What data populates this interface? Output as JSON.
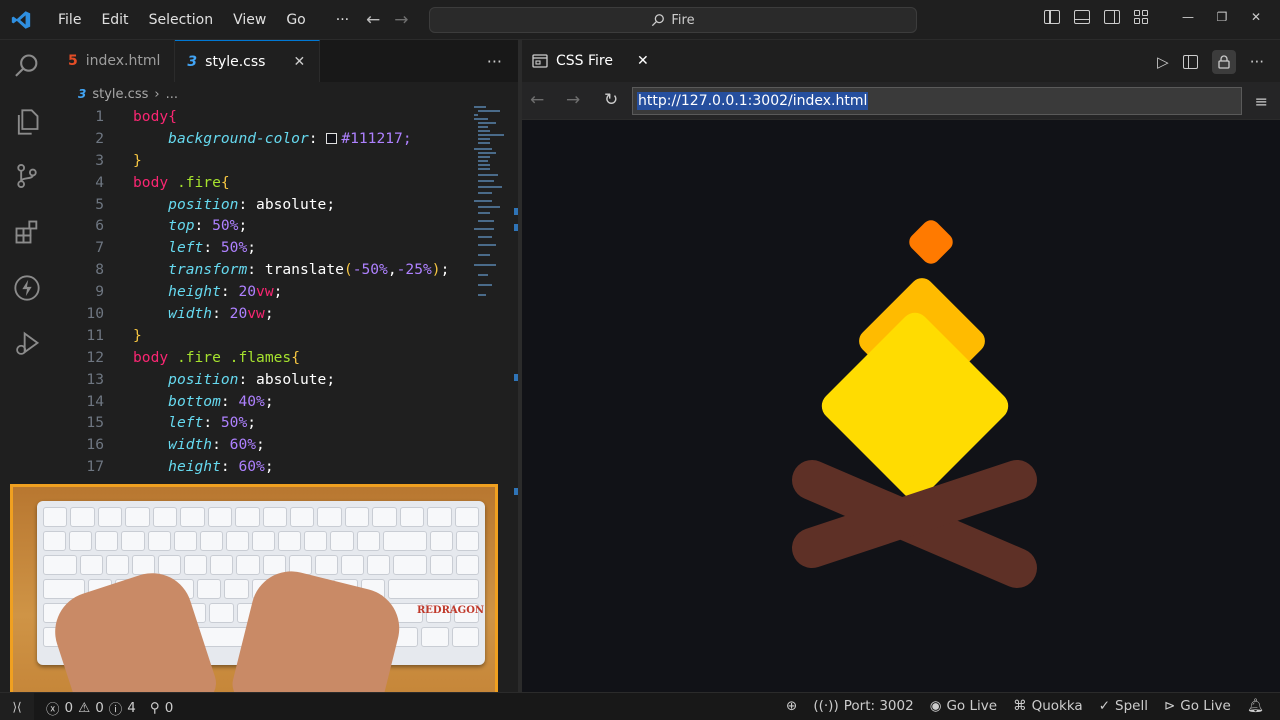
{
  "menu": [
    "File",
    "Edit",
    "Selection",
    "View",
    "Go",
    "···"
  ],
  "command_center": {
    "search_text": "Fire"
  },
  "editor": {
    "tabs": [
      {
        "label": "index.html",
        "icon": "html5-icon",
        "active": false
      },
      {
        "label": "style.css",
        "icon": "css3-icon",
        "active": true
      }
    ],
    "more": "···",
    "breadcrumb": {
      "file": "style.css",
      "separator": "›",
      "rest": "..."
    },
    "line_numbers": [
      "1",
      "2",
      "3",
      "4",
      "5",
      "6",
      "7",
      "8",
      "9",
      "10",
      "11",
      "12",
      "13",
      "14",
      "15",
      "16",
      "17"
    ],
    "code": {
      "l1": "body{",
      "l2_prop": "background-color",
      "l2_val": "#111217;",
      "l3": "}",
      "l4_sel": "body",
      "l4_cls": ".fire",
      "l4_brace": "{",
      "l5_prop": "position",
      "l5_val": "absolute;",
      "l6_prop": "top",
      "l6_num": "50%",
      "l7_prop": "left",
      "l7_num": "50%",
      "l8_prop": "transform",
      "l8_fn": "translate",
      "l8_a": "-50%",
      "l8_b": "-25%",
      "l9_prop": "height",
      "l9_num": "20",
      "l9_unit": "vw",
      "l10_prop": "width",
      "l10_num": "20",
      "l10_unit": "vw",
      "l11": "}",
      "l12_sel": "body",
      "l12_cls": ".fire .flames",
      "l12_brace": "{",
      "l13_prop": "position",
      "l13_val": "absolute;",
      "l14_prop": "bottom",
      "l14_num": "40%",
      "l15_prop": "left",
      "l15_num": "50%",
      "l16_prop": "width",
      "l16_num": "60%",
      "l17_prop": "height",
      "l17_num": "60%"
    }
  },
  "webcam": {
    "keyboard_brand": "REDRAGON"
  },
  "preview": {
    "tab_label": "CSS Fire",
    "url": "http://127.0.0.1:3002/index.html",
    "background": "#111217",
    "colors": {
      "spark": "#ff7a00",
      "flame_back": "#ffbb00",
      "flame_front": "#ffdc01",
      "log": "#5e3026"
    }
  },
  "statusbar": {
    "errors": "0",
    "warnings": "0",
    "info": "4",
    "ports": "0",
    "port": "Port: 3002",
    "go_live_1": "Go Live",
    "quokka": "Quokka",
    "spell": "Spell",
    "go_live_2": "Go Live"
  }
}
